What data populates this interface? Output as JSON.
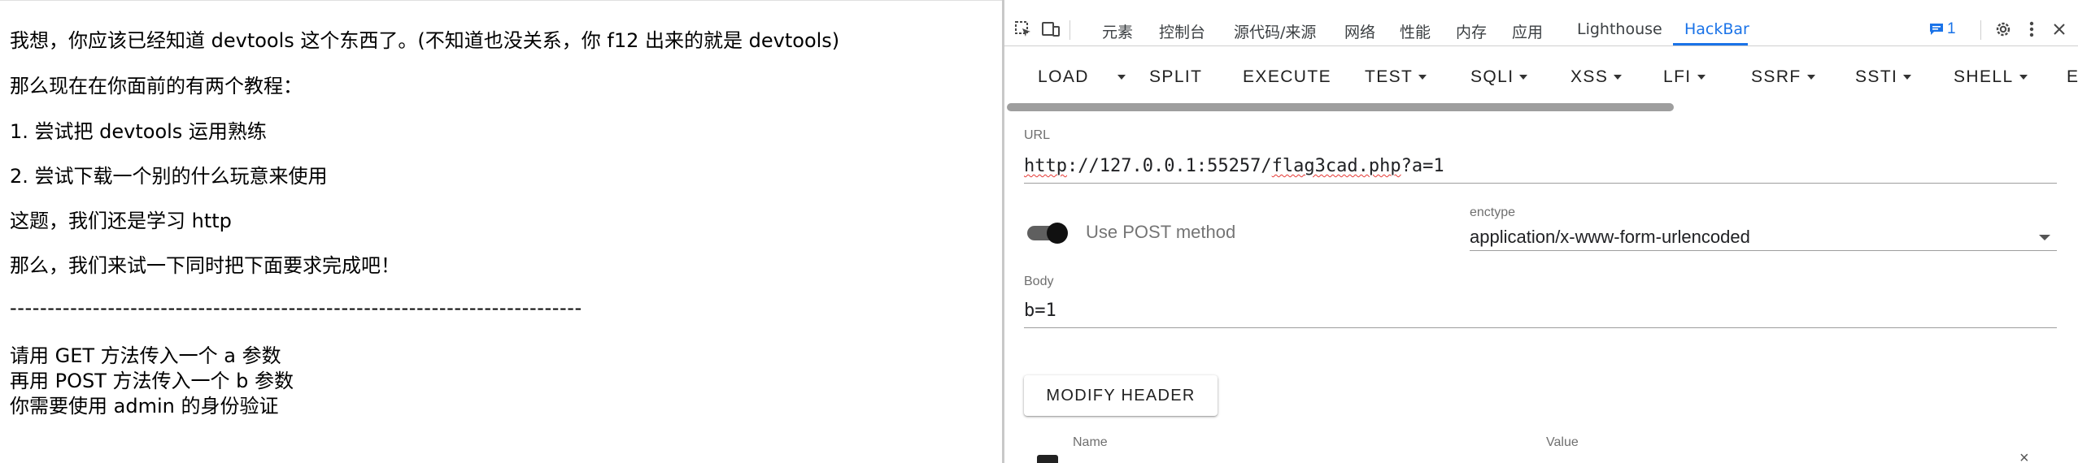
{
  "page": {
    "lines": [
      "我想，你应该已经知道 devtools 这个东西了。(不知道也没关系，你 f12 出来的就是 devtools)",
      "那么现在在你面前的有两个教程：",
      "1. 尝试把 devtools 运用熟练",
      "2. 尝试下载一个别的什么玩意来使用",
      "这题，我们还是学习 http",
      "那么，我们来试一下同时把下面要求完成吧！"
    ],
    "separator": "----------------------------------------------------------------------------",
    "requirements": [
      "请用 GET 方法传入一个 a 参数",
      "再用 POST 方法传入一个 b 参数",
      "你需要使用 admin 的身份验证"
    ]
  },
  "devtools": {
    "tabs": [
      "元素",
      "控制台",
      "源代码/来源",
      "网络",
      "性能",
      "内存",
      "应用",
      "Lighthouse",
      "HackBar"
    ],
    "active_tab": "HackBar",
    "issues_count": "1",
    "icons": [
      "inspect-element-icon",
      "device-toolbar-icon",
      "issues-icon",
      "settings-gear-icon",
      "more-vert-icon",
      "close-icon"
    ],
    "accent_color": "#1a73e8"
  },
  "hackbar": {
    "toolbar": {
      "load": "LOAD",
      "split": "SPLIT",
      "execute": "EXECUTE",
      "test": "TEST",
      "sqli": "SQLI",
      "xss": "XSS",
      "lfi": "LFI",
      "ssrf": "SSRF",
      "ssti": "SSTI",
      "shell": "SHELL",
      "cutoff": "E"
    },
    "url": {
      "label": "URL",
      "value_parts": [
        "http",
        "://127.0.0.1:55257/",
        "flag3cad.php",
        "?a=1"
      ]
    },
    "post": {
      "enabled": true,
      "label": "Use POST method"
    },
    "enctype": {
      "label": "enctype",
      "value": "application/x-www-form-urlencoded"
    },
    "body": {
      "label": "Body",
      "value": "b=1"
    },
    "modify_header": "MODIFY HEADER",
    "headers": {
      "name_label": "Name",
      "value_label": "Value"
    }
  }
}
